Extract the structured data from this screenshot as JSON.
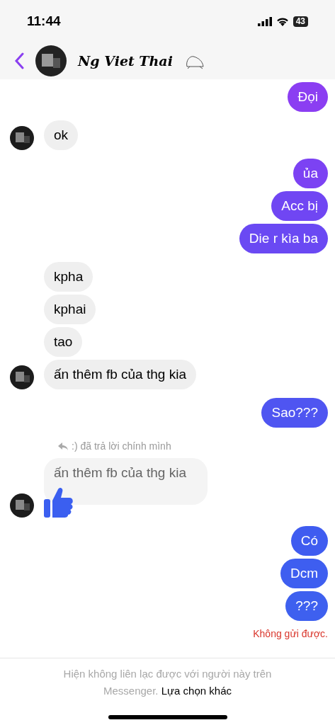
{
  "status_bar": {
    "time": "11:44",
    "battery": "43"
  },
  "header": {
    "name": "Ng Viet Thai"
  },
  "messages": [
    {
      "kind": "outgoing",
      "text": "Đọi"
    },
    {
      "kind": "incoming",
      "text": "ok",
      "avatar": true
    },
    {
      "kind": "outgoing",
      "text": "ủa"
    },
    {
      "kind": "outgoing",
      "text": "Acc bị"
    },
    {
      "kind": "outgoing",
      "text": "Die r kìa ba"
    },
    {
      "kind": "incoming",
      "text": "kpha",
      "avatar": false
    },
    {
      "kind": "incoming",
      "text": "kphai",
      "avatar": false
    },
    {
      "kind": "incoming",
      "text": "tao",
      "avatar": false
    },
    {
      "kind": "incoming",
      "text": "ấn thêm fb của thg kia",
      "avatar": true
    },
    {
      "kind": "outgoing",
      "text": "Sao???"
    },
    {
      "kind": "reply",
      "label": ":) đã trả lời chính mình",
      "text": "ấn thêm fb của thg kia",
      "avatar": true
    },
    {
      "kind": "outgoing",
      "text": "Có"
    },
    {
      "kind": "outgoing",
      "text": "Dcm"
    },
    {
      "kind": "outgoing",
      "text": "???"
    }
  ],
  "send_status": "Không gửi được.",
  "footer": {
    "text": "Hiện không liên lạc được với người này trên Messenger.",
    "link": "Lựa chọn khác"
  }
}
